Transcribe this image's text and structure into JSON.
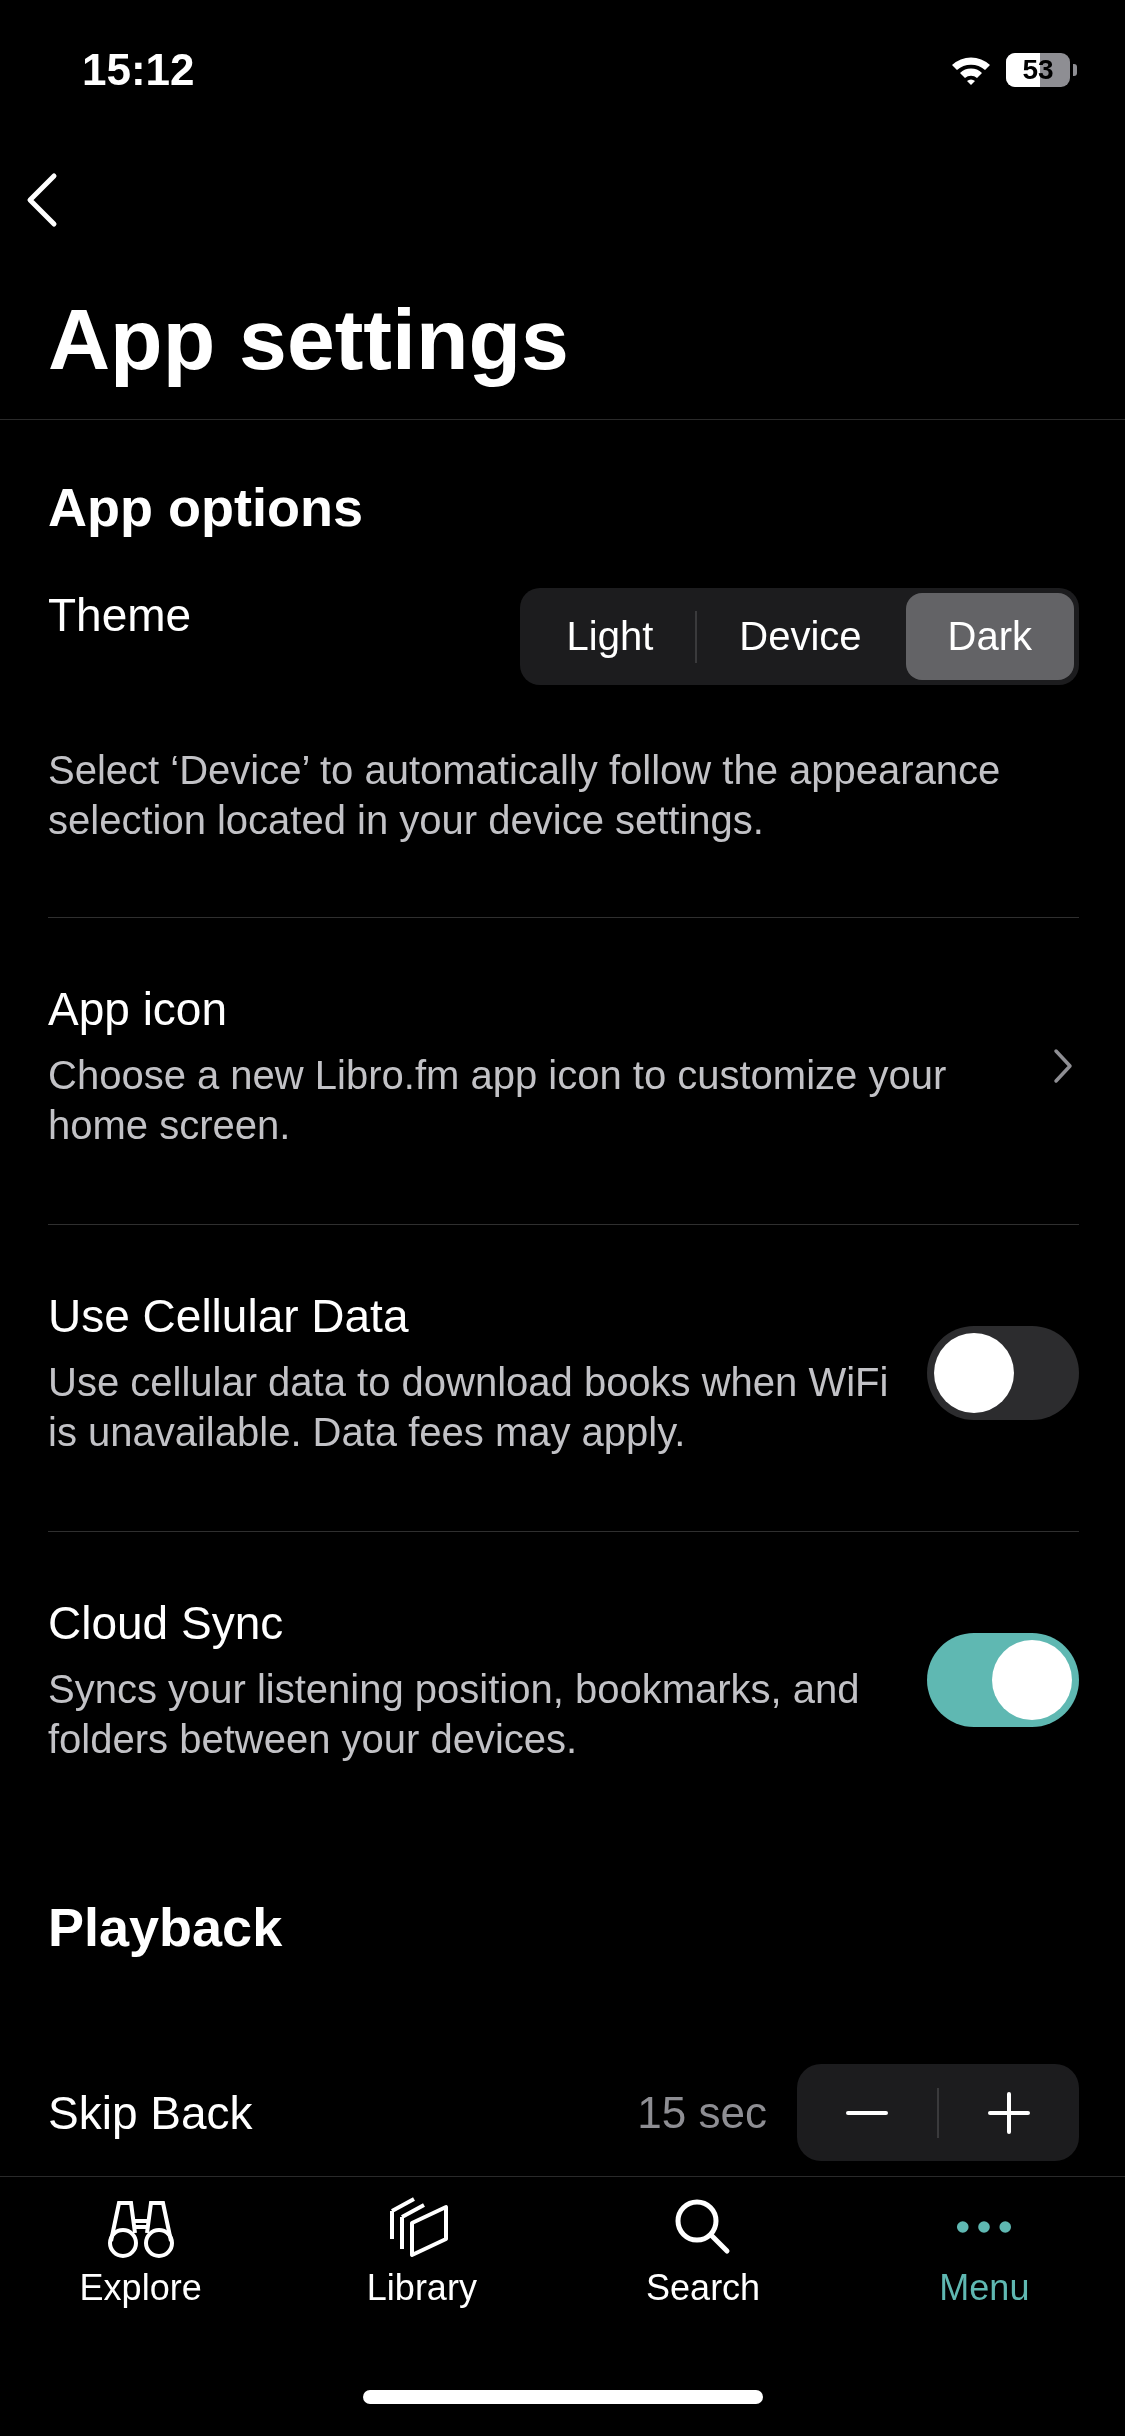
{
  "status_bar": {
    "time": "15:12",
    "battery": "53"
  },
  "header": {
    "title": "App settings"
  },
  "sections": [
    {
      "title": "App options",
      "rows": [
        {
          "kind": "segmented",
          "label": "Theme",
          "options": [
            {
              "label": "Light",
              "selected": false
            },
            {
              "label": "Device",
              "selected": false
            },
            {
              "label": "Dark",
              "selected": true
            }
          ],
          "description": "Select ‘Device’ to automatically follow the appearance selection located in your device settings."
        },
        {
          "kind": "link",
          "label": "App icon",
          "description": "Choose a new Libro.fm app icon to customize your home screen."
        },
        {
          "kind": "toggle",
          "label": "Use Cellular Data",
          "description": "Use cellular data to download books when WiFi is unavailable. Data fees may apply.",
          "on": false
        },
        {
          "kind": "toggle",
          "label": "Cloud Sync",
          "description": "Syncs your listening position, bookmarks, and folders between your devices.",
          "on": true
        }
      ]
    },
    {
      "title": "Playback",
      "rows": [
        {
          "kind": "stepper",
          "label": "Skip Back",
          "value": "15 sec"
        }
      ]
    }
  ],
  "tab_bar": [
    {
      "label": "Explore",
      "selected": false
    },
    {
      "label": "Library",
      "selected": false
    },
    {
      "label": "Search",
      "selected": false
    },
    {
      "label": "Menu",
      "selected": true
    }
  ]
}
